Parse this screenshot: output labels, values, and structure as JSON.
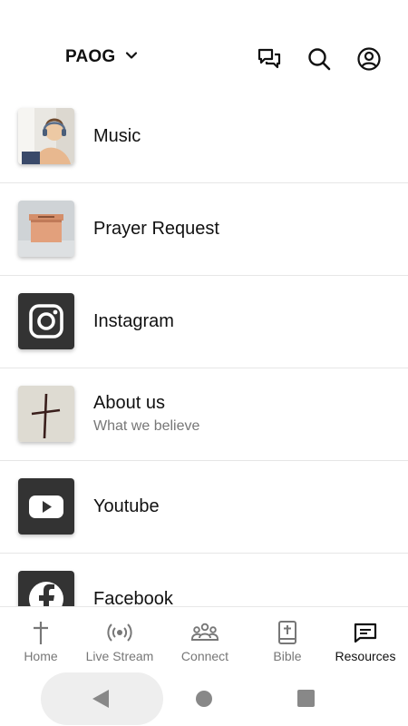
{
  "header": {
    "org_name": "PAOG"
  },
  "items": [
    {
      "title": "Music",
      "subtitle": ""
    },
    {
      "title": "Prayer Request",
      "subtitle": ""
    },
    {
      "title": "Instagram",
      "subtitle": ""
    },
    {
      "title": "About us",
      "subtitle": "What we believe"
    },
    {
      "title": "Youtube",
      "subtitle": ""
    },
    {
      "title": "Facebook",
      "subtitle": ""
    }
  ],
  "nav": {
    "active": "Resources",
    "items": [
      {
        "label": "Home",
        "icon": "cross-icon"
      },
      {
        "label": "Live Stream",
        "icon": "broadcast-icon"
      },
      {
        "label": "Connect",
        "icon": "group-icon"
      },
      {
        "label": "Bible",
        "icon": "bible-icon"
      },
      {
        "label": "Resources",
        "icon": "resources-icon"
      }
    ]
  },
  "colors": {
    "accent": "#111111",
    "inactive": "#777777",
    "divider": "#e6e6e6"
  }
}
